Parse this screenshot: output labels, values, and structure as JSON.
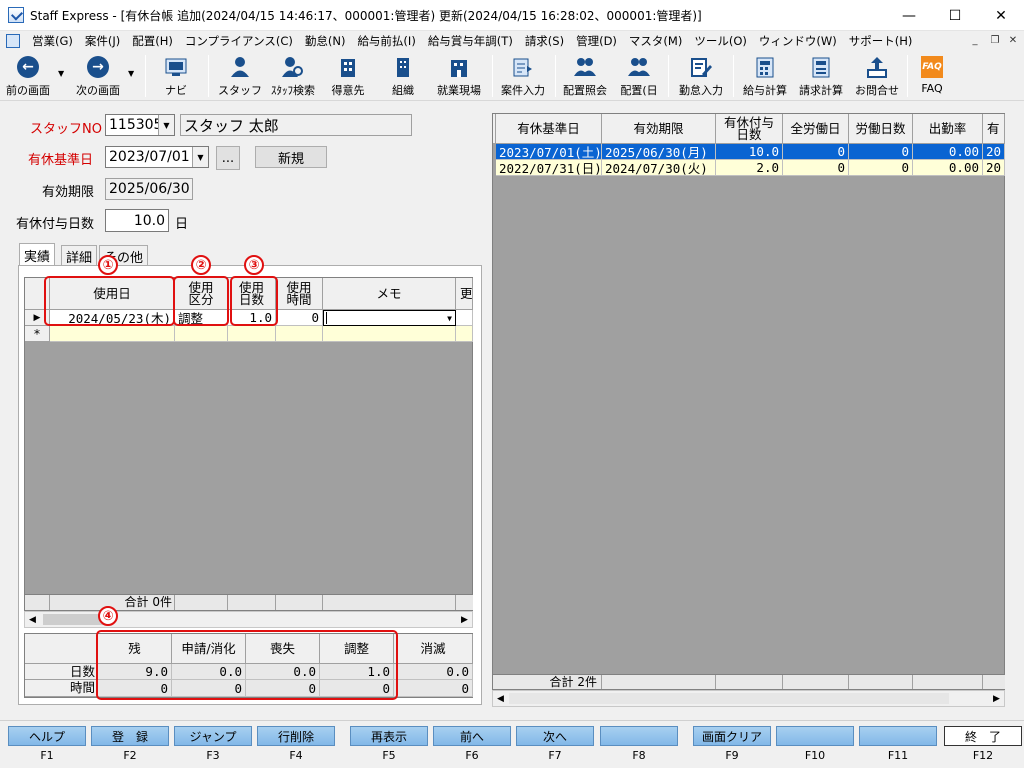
{
  "window": {
    "title": "Staff Express - [有休台帳  追加(2024/04/15 14:46:17、000001:管理者) 更新(2024/04/15 16:28:02、000001:管理者)]",
    "min": "—",
    "max": "☐",
    "close": "✕"
  },
  "menu": [
    "営業(G)",
    "案件(J)",
    "配置(H)",
    "コンプライアンス(C)",
    "勤怠(N)",
    "給与前払(I)",
    "給与賞与年調(T)",
    "請求(S)",
    "管理(D)",
    "マスタ(M)",
    "ツール(O)",
    "ウィンドウ(W)",
    "サポート(H)"
  ],
  "toolbar": {
    "prev": "前の画面",
    "next": "次の画面",
    "navi": "ナビ",
    "staff": "スタッフ",
    "staff_search": "ｽﾀｯﾌ検索",
    "client": "得意先",
    "org": "組織",
    "site": "就業現場",
    "case_input": "案件入力",
    "assign_view": "配置照会",
    "assign_day": "配置(日",
    "attendance_input": "勤怠入力",
    "payroll": "給与計算",
    "billing": "請求計算",
    "inquiry": "お問合せ",
    "faq": "FAQ"
  },
  "colors": {
    "accent": "#0a64d2",
    "annotation": "#e01010",
    "fkey": "#82b8e8"
  },
  "form": {
    "staff_no_label": "スタッフNO",
    "staff_no": "115305",
    "staff_name": "スタッフ  太郎",
    "base_date_label": "有休基準日",
    "base_date": "2023/07/01",
    "ellipsis": "...",
    "new_button": "新規",
    "expiry_label": "有効期限",
    "expiry": "2025/06/30",
    "grant_days_label": "有休付与日数",
    "grant_days": "10.0",
    "days_unit": "日"
  },
  "tabs": [
    "実績",
    "詳細",
    "その他"
  ],
  "usage_grid": {
    "headers": [
      "使用日",
      "使用\n区分",
      "使用\n日数",
      "使用\n時間",
      "メモ",
      "更"
    ],
    "rows": [
      [
        "2024/05/23(木)",
        "調整",
        "1.0",
        "0",
        ""
      ]
    ],
    "new_row_marker": "*",
    "current_row_marker": "▶",
    "footer": "合計  0件"
  },
  "summary": {
    "headers": [
      "残",
      "申請/消化",
      "喪失",
      "調整",
      "消滅"
    ],
    "rows": [
      {
        "label": "日数",
        "values": [
          "9.0",
          "0.0",
          "0.0",
          "1.0",
          "0.0"
        ]
      },
      {
        "label": "時間",
        "values": [
          "0",
          "0",
          "0",
          "0",
          "0"
        ]
      }
    ]
  },
  "annotations": [
    "①",
    "②",
    "③",
    "④"
  ],
  "right_grid": {
    "headers": [
      "有休基準日",
      "有効期限",
      "有休付与\n日数",
      "全労働日",
      "労働日数",
      "出勤率",
      "有"
    ],
    "rows": [
      [
        "2023/07/01(土)",
        "2025/06/30(月)",
        "10.0",
        "0",
        "0",
        "0.00",
        "20"
      ],
      [
        "2022/07/31(日)",
        "2024/07/30(火)",
        "2.0",
        "0",
        "0",
        "0.00",
        "20"
      ]
    ],
    "footer": "合計  2件"
  },
  "fkeys": [
    {
      "label": "ヘルプ",
      "key": "F1"
    },
    {
      "label": "登　録",
      "key": "F2"
    },
    {
      "label": "ジャンプ",
      "key": "F3"
    },
    {
      "label": "行削除",
      "key": "F4"
    },
    {
      "label": "再表示",
      "key": "F5"
    },
    {
      "label": "前へ",
      "key": "F6"
    },
    {
      "label": "次へ",
      "key": "F7"
    },
    {
      "label": "",
      "key": "F8"
    },
    {
      "label": "画面クリア",
      "key": "F9"
    },
    {
      "label": "",
      "key": "F10"
    },
    {
      "label": "",
      "key": "F11"
    },
    {
      "label": "終　了",
      "key": "F12"
    }
  ]
}
